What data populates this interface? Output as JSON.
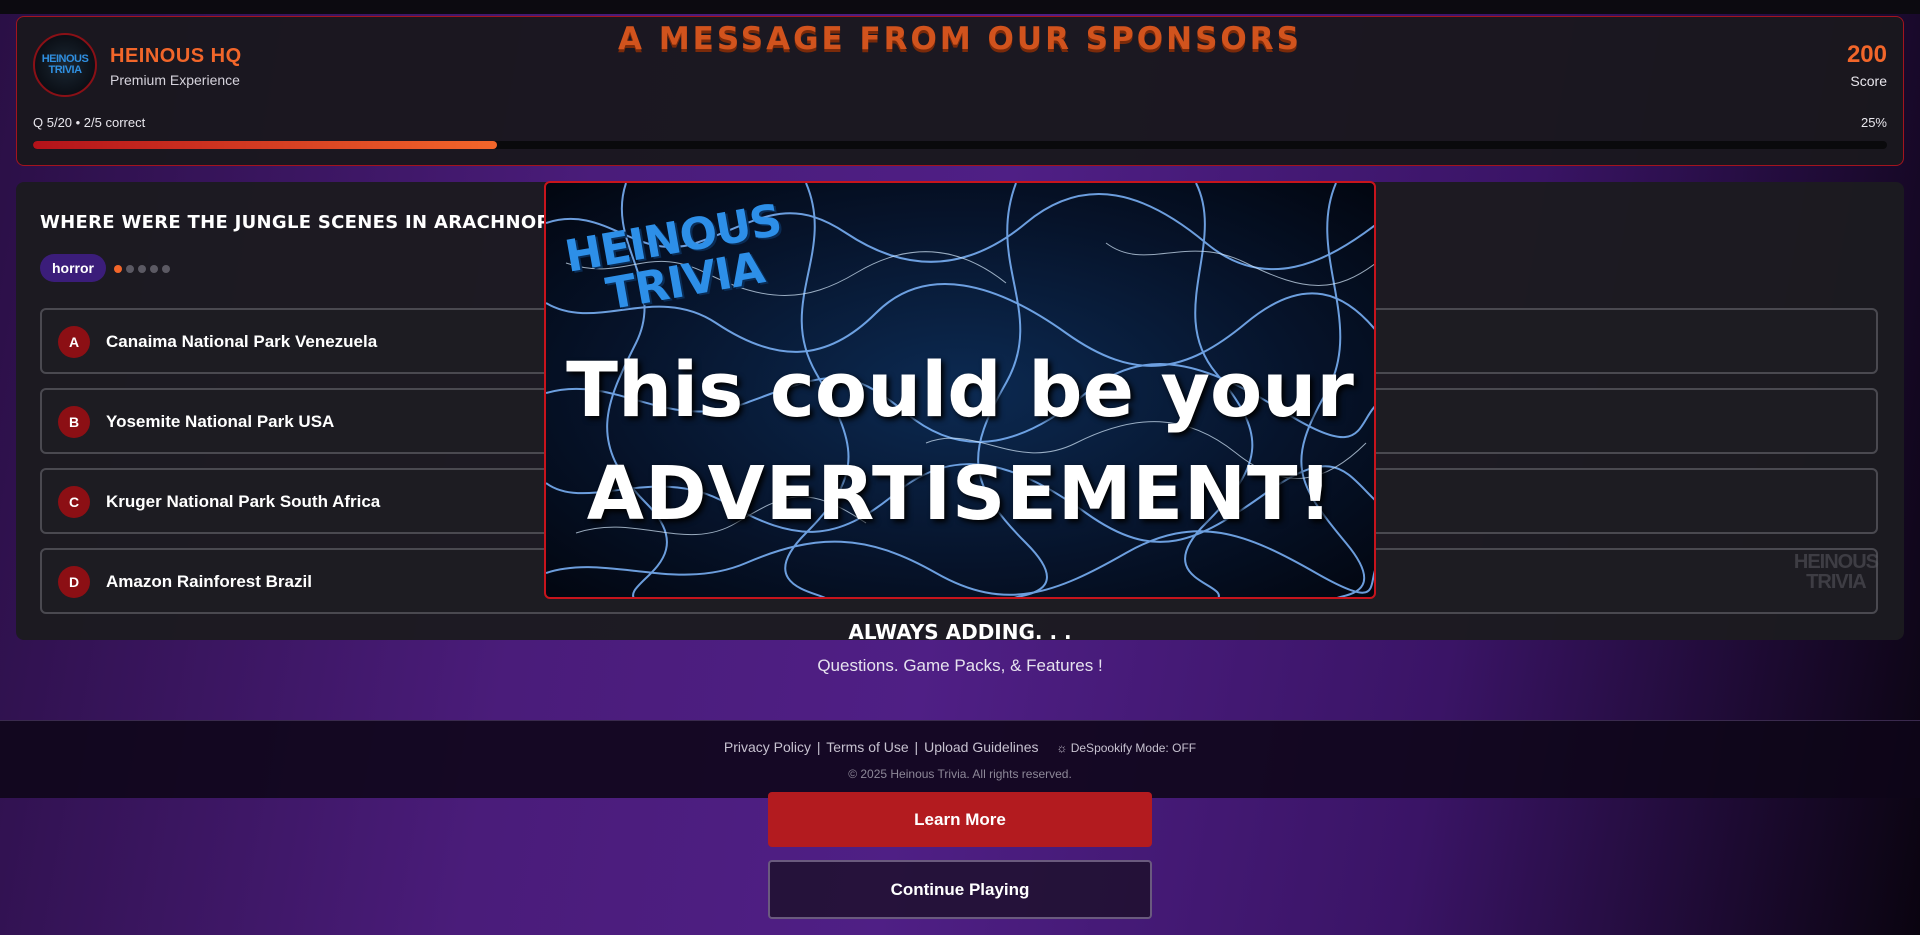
{
  "header": {
    "logo_text": [
      "HEINOUS",
      "TRIVIA"
    ],
    "brand_name": "HEINOUS HQ",
    "brand_sub": "Premium Experience",
    "sponsor_title": "A MESSAGE FROM OUR SPONSORS",
    "score_value": "200",
    "score_label": "Score",
    "question_status": "Q 5/20 • 2/5 correct",
    "progress_percent_label": "25%",
    "progress_fraction": 0.25
  },
  "question": {
    "text": "WHERE WERE THE JUNGLE SCENES IN ARACHNOPHOBIA FILMED?",
    "category_tag": "horror",
    "difficulty_dots_total": 5,
    "difficulty_dots_active": 1,
    "answers": [
      {
        "letter": "A",
        "text": "Canaima National Park Venezuela"
      },
      {
        "letter": "B",
        "text": "Yosemite National Park USA"
      },
      {
        "letter": "C",
        "text": "Kruger National Park South Africa"
      },
      {
        "letter": "D",
        "text": "Amazon Rainforest Brazil"
      }
    ],
    "watermark": [
      "HEINOUS",
      "TRIVIA"
    ]
  },
  "promo": {
    "title": "ALWAYS ADDING. . .",
    "subtitle": "Questions. Game Packs, & Features !"
  },
  "footer": {
    "privacy": "Privacy Policy",
    "terms": "Terms of Use",
    "upload": "Upload Guidelines",
    "sep": "|",
    "despookify": "DeSpookify Mode: OFF",
    "copyright": "© 2025 Heinous Trivia. All rights reserved."
  },
  "ad": {
    "logo_line1": "HEINOUS",
    "logo_line2": "TRIVIA",
    "headline_line1": "This could be your",
    "headline_line2": "ADVERTISEMENT!",
    "learn_more": "Learn More",
    "continue_playing": "Continue Playing"
  },
  "colors": {
    "accent_orange": "#f2662a",
    "accent_red": "#b31b1f",
    "tag_purple": "#3b1d7a",
    "lightning_blue": "#2d8fe8"
  }
}
